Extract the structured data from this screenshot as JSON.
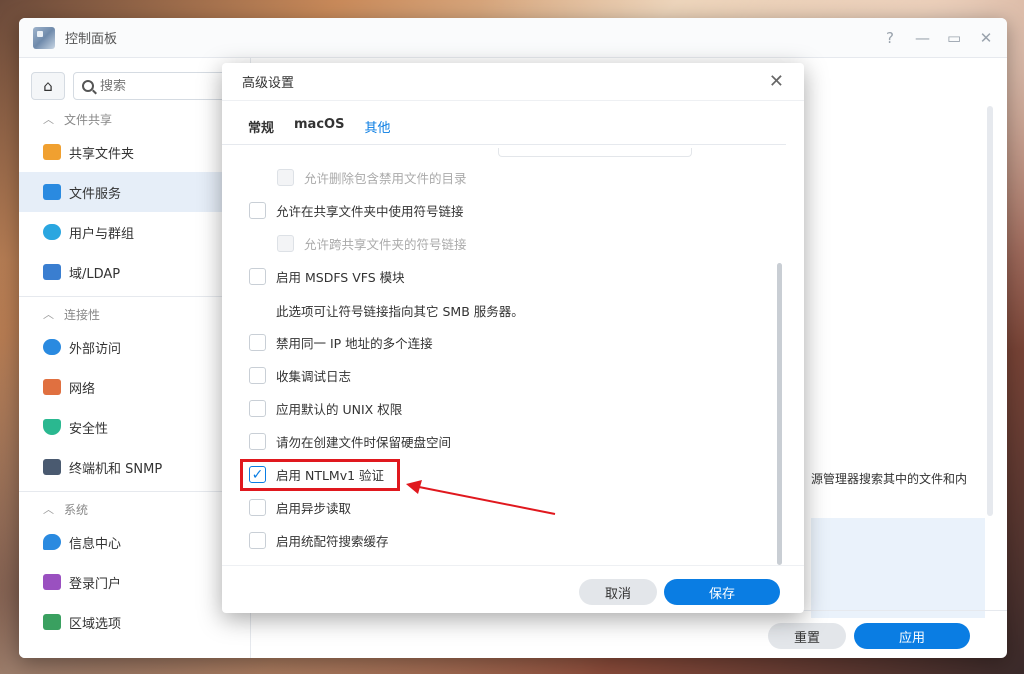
{
  "window": {
    "title": "控制面板",
    "controls": {
      "help": "?",
      "minimize": "—",
      "maximize": "▭",
      "close": "✕"
    }
  },
  "sidebar": {
    "search_placeholder": "搜索",
    "sections": [
      {
        "label": "文件共享",
        "items": [
          "共享文件夹",
          "文件服务",
          "用户与群组",
          "域/LDAP"
        ]
      },
      {
        "label": "连接性",
        "items": [
          "外部访问",
          "网络",
          "安全性",
          "终端机和 SNMP"
        ]
      },
      {
        "label": "系统",
        "items": [
          "信息中心",
          "登录门户",
          "区域选项"
        ]
      }
    ],
    "active_item": "文件服务"
  },
  "main": {
    "partial_text": "源管理器搜索其中的文件和内",
    "reset_label": "重置",
    "apply_label": "应用"
  },
  "dialog": {
    "title": "高级设置",
    "close": "✕",
    "tabs": [
      "常规",
      "macOS",
      "其他"
    ],
    "active_tab": "其他",
    "options": {
      "sub1": "允许删除包含禁用文件的目录",
      "opt1": "允许在共享文件夹中使用符号链接",
      "sub2": "允许跨共享文件夹的符号链接",
      "opt2": "启用 MSDFS VFS 模块",
      "note": "此选项可让符号链接指向其它 SMB 服务器。",
      "opt3": "禁用同一 IP 地址的多个连接",
      "opt4": "收集调试日志",
      "opt5": "应用默认的 UNIX 权限",
      "opt6": "请勿在创建文件时保留硬盘空间",
      "opt7": "启用 NTLMv1 验证",
      "opt8": "启用异步读取",
      "opt9": "启用统配符搜索缓存"
    },
    "checked_option": "opt7",
    "cancel_label": "取消",
    "save_label": "保存"
  },
  "colors": {
    "accent": "#0a7de3",
    "annotation": "#e0181e"
  }
}
